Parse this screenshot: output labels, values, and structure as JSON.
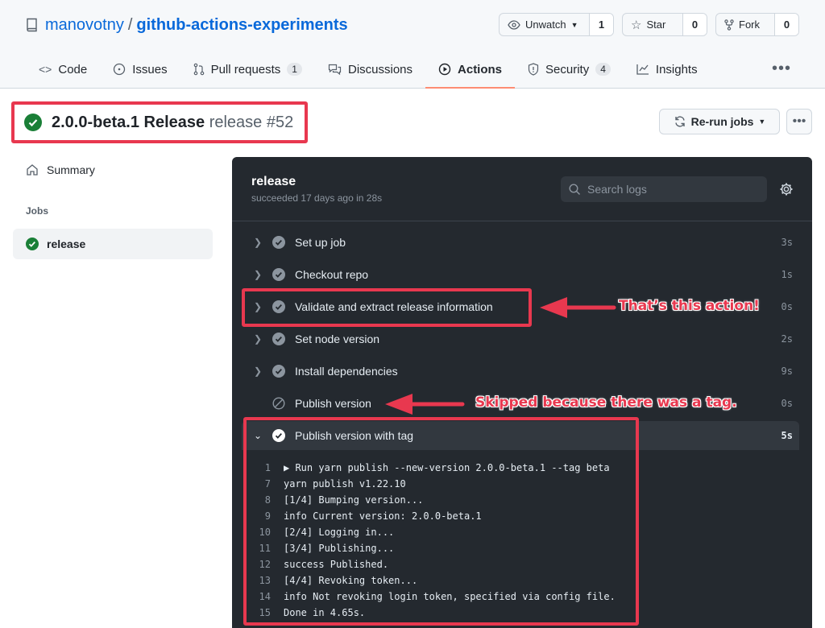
{
  "repo": {
    "owner": "manovotny",
    "separator": "/",
    "name": "github-actions-experiments",
    "unwatch_label": "Unwatch",
    "unwatch_count": "1",
    "star_label": "Star",
    "star_count": "0",
    "fork_label": "Fork",
    "fork_count": "0"
  },
  "tabs": [
    {
      "label": "Code",
      "icon": "code-icon"
    },
    {
      "label": "Issues",
      "icon": "issue-icon"
    },
    {
      "label": "Pull requests",
      "icon": "pull-request-icon",
      "badge": "1"
    },
    {
      "label": "Discussions",
      "icon": "discussion-icon"
    },
    {
      "label": "Actions",
      "icon": "play-icon",
      "active": true
    },
    {
      "label": "Security",
      "icon": "shield-icon",
      "badge": "4"
    },
    {
      "label": "Insights",
      "icon": "graph-icon"
    }
  ],
  "run": {
    "title": "2.0.0-beta.1 Release",
    "workflow": "release #52",
    "rerun_label": "Re-run jobs"
  },
  "sidebar": {
    "summary_label": "Summary",
    "jobs_heading": "Jobs",
    "job_name": "release"
  },
  "job": {
    "title": "release",
    "subtitle": "succeeded 17 days ago in 28s",
    "search_placeholder": "Search logs"
  },
  "steps": [
    {
      "label": "Set up job",
      "duration": "3s",
      "status": "success"
    },
    {
      "label": "Checkout repo",
      "duration": "1s",
      "status": "success"
    },
    {
      "label": "Validate and extract release information",
      "duration": "0s",
      "status": "success"
    },
    {
      "label": "Set node version",
      "duration": "2s",
      "status": "success"
    },
    {
      "label": "Install dependencies",
      "duration": "9s",
      "status": "success"
    },
    {
      "label": "Publish version",
      "duration": "0s",
      "status": "skipped"
    },
    {
      "label": "Publish version with tag",
      "duration": "5s",
      "status": "success",
      "expanded": true
    }
  ],
  "log_lines": [
    {
      "n": "1",
      "text": "▶ Run yarn publish --new-version 2.0.0-beta.1 --tag beta"
    },
    {
      "n": "7",
      "text": "yarn publish v1.22.10"
    },
    {
      "n": "8",
      "text": "[1/4] Bumping version..."
    },
    {
      "n": "9",
      "text": "info Current version: 2.0.0-beta.1"
    },
    {
      "n": "10",
      "text": "[2/4] Logging in..."
    },
    {
      "n": "11",
      "text": "[3/4] Publishing..."
    },
    {
      "n": "12",
      "text": "success Published."
    },
    {
      "n": "13",
      "text": "[4/4] Revoking token..."
    },
    {
      "n": "14",
      "text": "info Not revoking login token, specified via config file."
    },
    {
      "n": "15",
      "text": "Done in 4.65s."
    }
  ],
  "annotations": {
    "action_note": "That’s this action!",
    "skip_note": "Skipped because there was a tag."
  },
  "colors": {
    "accent_red": "#e8384f",
    "success_green": "#1a7f37",
    "panel_bg": "#24292f",
    "link_blue": "#0969da"
  }
}
